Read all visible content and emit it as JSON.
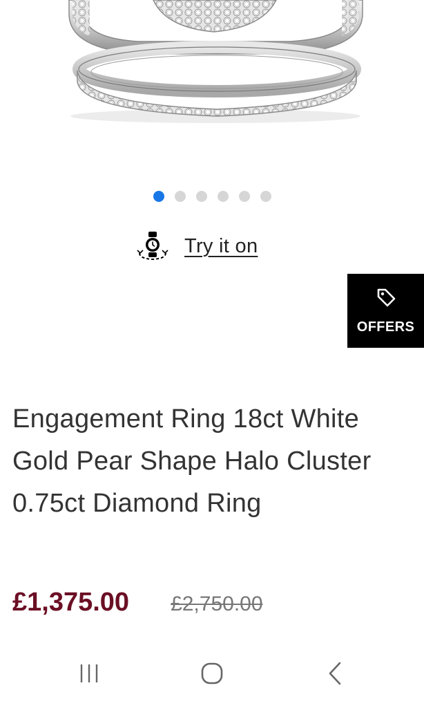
{
  "carousel": {
    "dot_count": 6,
    "active_index": 0
  },
  "try_on": {
    "label": "Try it on",
    "icon": "ar-try-on-icon"
  },
  "offers": {
    "label": "OFFERS",
    "icon": "tag-icon"
  },
  "product": {
    "title": "Engagement Ring 18ct White Gold Pear Shape Halo Cluster 0.75ct Diamond Ring",
    "price_current": "£1,375.00",
    "price_was": "£2,750.00"
  },
  "system_nav": {
    "recents_icon": "recent-apps-icon",
    "home_icon": "home-icon",
    "back_icon": "back-icon"
  },
  "colors": {
    "accent_dot": "#1877e6",
    "price": "#6b0f24",
    "offers_bg": "#000000"
  }
}
